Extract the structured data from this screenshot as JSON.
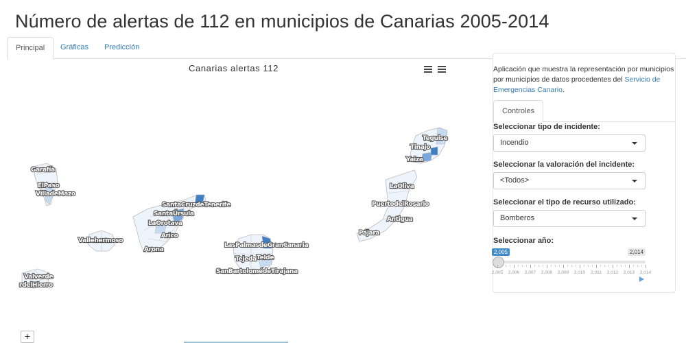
{
  "page": {
    "title": "Número de alertas de 112 en municipios de Canarias 2005-2014"
  },
  "tabs": [
    {
      "label": "Principal",
      "active": true
    },
    {
      "label": "Gráficas",
      "active": false
    },
    {
      "label": "Predicción",
      "active": false
    }
  ],
  "map": {
    "title": "Canarias alertas 112",
    "zoom_in_label": "+",
    "municipality_labels": [
      "Garafía",
      "El Paso",
      "Villa de Mazo",
      "Valverde",
      "La Frontera / El Hierro",
      "Vallehermoso",
      "Santa Cruz de Tenerife",
      "Santa Úrsula",
      "La Orotava",
      "Arico",
      "Arona",
      "Las Palmas de Gran Canaria",
      "Tejeda",
      "Telde",
      "San Bartolomé de Tirajana",
      "Teguise",
      "Tinajo",
      "Yaiza",
      "La Oliva",
      "Puerto del Rosario",
      "Antigua",
      "Pájara"
    ],
    "label_text": {
      "garafia": "Garafía",
      "elpaso": "ElPaso",
      "villademazo": "VilladeMazo",
      "valverde": "Valverde",
      "frontera": "rdelHierro",
      "vallehermoso": "Vallehermoso",
      "santacruz": "SantaCruzdeTenerife",
      "santaursula": "SantaÚrsula",
      "laorotava": "LaOrotava",
      "arico": "Arico",
      "arona": "Arona",
      "laspalmas": "LasPalmasdeGranCanaria",
      "tejeda": "Tejeda",
      "telde": "Telde",
      "sanbartolome": "SanBartolomédeTirajana",
      "teguise": "Teguise",
      "tinajo": "Tinajo",
      "yaiza": "Yaiza",
      "laoliva": "LaOliva",
      "puertodelrosario": "PuertodelRosario",
      "antigua": "Antigua",
      "pajara": "Pájara"
    },
    "colors": {
      "dark": "#3f7fc4",
      "mid": "#7aa8dc",
      "light": "#c6dbf2",
      "pale": "#eef4fb",
      "outline": "#bbbbbb"
    }
  },
  "panel": {
    "description_prefix": "Aplicación que muestra la representación por municipios por municipios de datos procedentes del ",
    "description_link": "Servicio de Emergencias Canario",
    "description_suffix": ".",
    "controls_tab": "Controles",
    "incident_type": {
      "label": "Seleccionar tipo de incidente:",
      "value": "Incendio"
    },
    "valuation": {
      "label": "Seleccionar la valoración del incidente:",
      "value": "<Todos>"
    },
    "resource": {
      "label": "Seleccionar el tipo de recurso utilizado:",
      "value": "Bomberos"
    },
    "year": {
      "label": "Seleccionar año:",
      "min_value": "2,005",
      "max_value": "2,014",
      "selected_range": [
        2005,
        2014
      ],
      "tick_labels": [
        "2,005",
        "2,006",
        "2,007",
        "2,008",
        "2,009",
        "2,010",
        "2,011",
        "2,012",
        "2,013",
        "2,014"
      ]
    }
  }
}
